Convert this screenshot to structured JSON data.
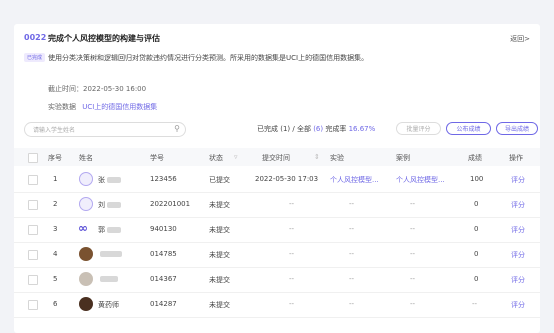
{
  "header": {
    "code": "0022",
    "title": "完成个人风控模型的构建与评估",
    "back": "返回>"
  },
  "status_badge": "已完成",
  "description": "使用分类决策树和逻辑回归对贷款违约情况进行分类预测。所采用的数据集是UCI上的德国信用数据集。",
  "deadline": "截止时间：2022-05-30 16:00",
  "experiment": {
    "label": "实验数据",
    "link": "UCI上的德国信用数据集"
  },
  "search": {
    "placeholder": "请输入学生姓名"
  },
  "stats": {
    "completed_label": "已完成",
    "completed": "(1)",
    "sep": " / 全部",
    "total": "(6)",
    "rate_label": " 完成率",
    "rate": "16.67%"
  },
  "buttons": {
    "batch": "批量评分",
    "publish": "公布成绩",
    "export": "导出成绩"
  },
  "columns": [
    "序号",
    "姓名",
    "学号",
    "状态",
    "提交时间",
    "实验",
    "案例",
    "成绩",
    "操作"
  ],
  "rows": [
    {
      "idx": "1",
      "name": "张",
      "id": "123456",
      "status": "已提交",
      "time": "2022-05-30 17:03",
      "exp": "个人风控模型...",
      "case": "个人风控模型...",
      "score": "100",
      "op": "评分"
    },
    {
      "idx": "2",
      "name": "刘",
      "id": "202201001",
      "status": "未提交",
      "time": "--",
      "exp": "--",
      "case": "--",
      "score": "0",
      "op": "评分"
    },
    {
      "idx": "3",
      "name": "郭",
      "id": "940130",
      "status": "未提交",
      "time": "--",
      "exp": "--",
      "case": "--",
      "score": "0",
      "op": "评分"
    },
    {
      "idx": "4",
      "name": "",
      "id": "014785",
      "status": "未提交",
      "time": "--",
      "exp": "--",
      "case": "--",
      "score": "0",
      "op": "评分"
    },
    {
      "idx": "5",
      "name": "",
      "id": "014367",
      "status": "未提交",
      "time": "--",
      "exp": "--",
      "case": "--",
      "score": "0",
      "op": "评分"
    },
    {
      "idx": "6",
      "name": "黄药师",
      "id": "014287",
      "status": "未提交",
      "time": "--",
      "exp": "--",
      "case": "--",
      "score": "--",
      "op": "评分"
    }
  ]
}
